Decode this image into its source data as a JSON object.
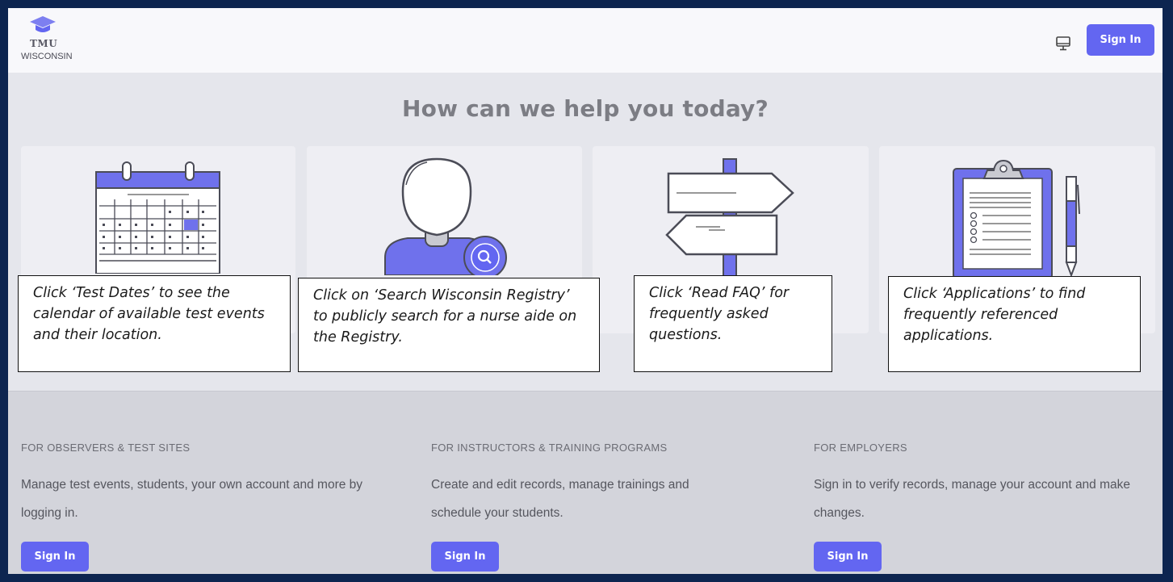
{
  "header": {
    "logo_line1": "TMU",
    "logo_line2": "WISCONSIN",
    "sign_in_label": "Sign In"
  },
  "main": {
    "heading": "How can we help you today?"
  },
  "callouts": [
    {
      "text": "Click ‘Test Dates’ to see the calendar of available test events and their location."
    },
    {
      "text": "Click on ‘Search Wisconsin Registry’ to publicly search for a nurse aide on the Registry."
    },
    {
      "text": "Click ‘Read FAQ’ for frequently asked questions."
    },
    {
      "text": "Click ‘Applications’ to find frequently referenced applications."
    }
  ],
  "sections": [
    {
      "title": "FOR OBSERVERS & TEST SITES",
      "description": "Manage test events, students, your own account and more by logging in.",
      "button": "Sign In"
    },
    {
      "title": "FOR INSTRUCTORS & TRAINING PROGRAMS",
      "description": "Create and edit records, manage trainings and schedule your students.",
      "button": "Sign In"
    },
    {
      "title": "FOR EMPLOYERS",
      "description": "Sign in to verify records, manage your account and make changes.",
      "button": "Sign In"
    }
  ],
  "colors": {
    "accent": "#6366f1",
    "frame_border": "#0d2550",
    "background": "#e5e6ec",
    "lower_background": "#d3d4db"
  },
  "icons": [
    "graduation-cap-icon",
    "monitor-icon",
    "calendar-icon",
    "person-search-icon",
    "signpost-icon",
    "clipboard-icon"
  ]
}
